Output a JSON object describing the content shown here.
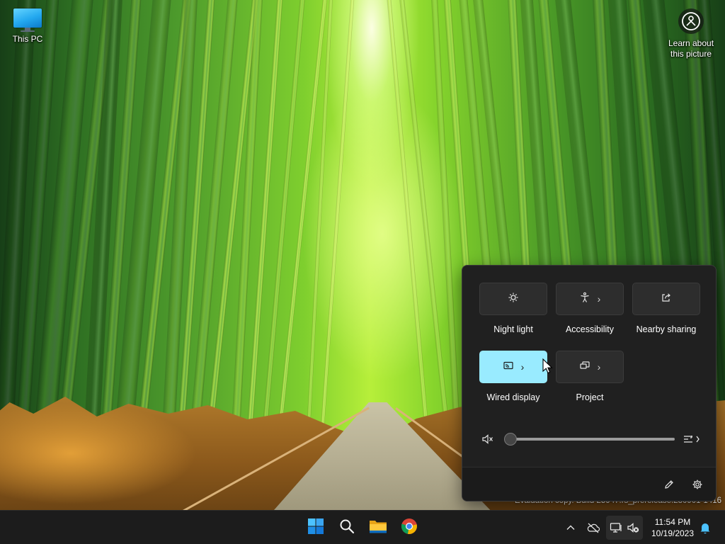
{
  "desktop": {
    "icons": [
      {
        "label": "This PC"
      }
    ],
    "learn_about": {
      "label_line1": "Learn about",
      "label_line2": "this picture"
    },
    "watermark": {
      "line2": "Evaluation copy. Build 25947.rs_prerelease.230901-1416"
    }
  },
  "quick_settings": {
    "tiles": [
      {
        "label": "Night light",
        "icon": "night-light-icon",
        "has_chevron": false,
        "active": false
      },
      {
        "label": "Accessibility",
        "icon": "accessibility-icon",
        "has_chevron": true,
        "active": false
      },
      {
        "label": "Nearby sharing",
        "icon": "nearby-sharing-icon",
        "has_chevron": false,
        "active": false
      },
      {
        "label": "Wired display",
        "icon": "cast-icon",
        "has_chevron": true,
        "active": true
      },
      {
        "label": "Project",
        "icon": "project-icon",
        "has_chevron": true,
        "active": false
      }
    ],
    "volume": {
      "level": 0,
      "muted": true,
      "icon": "speaker-muted-icon",
      "mixer_icon": "audio-mixer-icon"
    },
    "footer": {
      "edit_icon": "pencil-icon",
      "settings_icon": "gear-icon"
    },
    "colors": {
      "panel": "#202020",
      "tile": "#2d2d2d",
      "active_tile": "#99ebff"
    }
  },
  "taskbar": {
    "apps": [
      {
        "name": "Start",
        "icon": "windows-logo-icon"
      },
      {
        "name": "Search",
        "icon": "search-icon"
      },
      {
        "name": "File Explorer",
        "icon": "folder-icon"
      },
      {
        "name": "Google Chrome",
        "icon": "chrome-icon"
      }
    ],
    "tray": [
      {
        "icon": "chevron-up-icon"
      },
      {
        "icon": "onedrive-offline-icon"
      },
      {
        "icon": "network-icon"
      },
      {
        "icon": "volume-muted-icon"
      }
    ],
    "clock": {
      "time": "11:54 PM",
      "date": "10/19/2023"
    },
    "notification_icon": "bell-icon"
  }
}
